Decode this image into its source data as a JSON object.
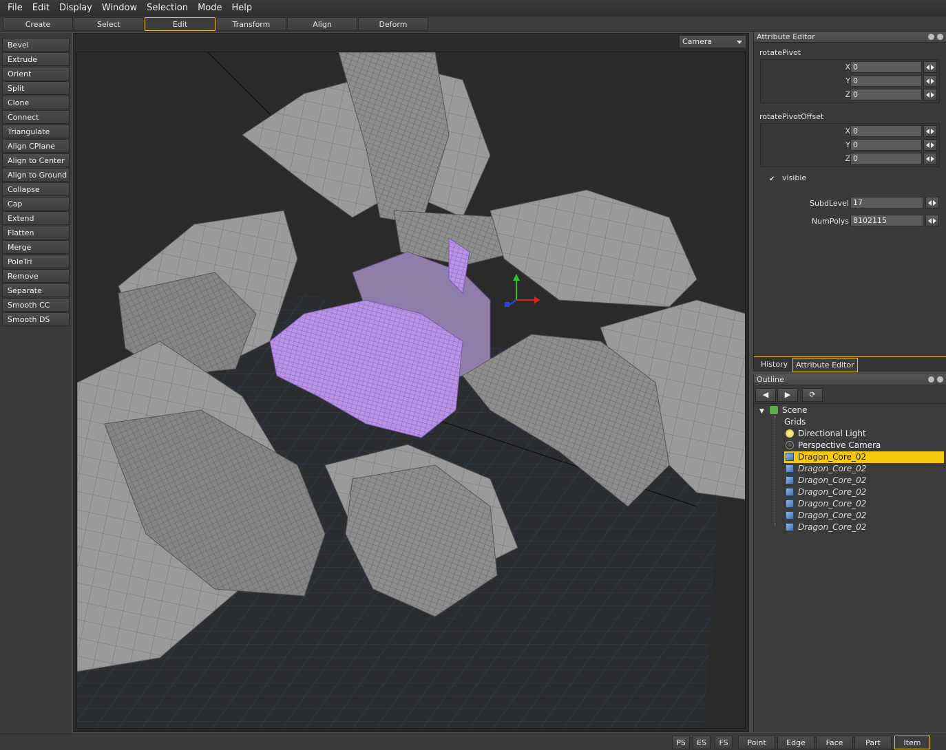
{
  "menubar": {
    "items": [
      "File",
      "Edit",
      "Display",
      "Window",
      "Selection",
      "Mode",
      "Help"
    ]
  },
  "mode_tabs": {
    "items": [
      "Create",
      "Select",
      "Edit",
      "Transform",
      "Align",
      "Deform"
    ],
    "active": "Edit"
  },
  "tools": {
    "items": [
      "Bevel",
      "Extrude",
      "Orient",
      "Split",
      "Clone",
      "Connect",
      "Triangulate",
      "Align CPlane",
      "Align to Center",
      "Align to Ground",
      "Collapse",
      "Cap",
      "Extend",
      "Flatten",
      "Merge",
      "PoleTri",
      "Remove",
      "Separate",
      "Smooth CC",
      "Smooth DS"
    ]
  },
  "viewport": {
    "camera_select": "Camera"
  },
  "attribute_editor": {
    "title": "Attribute Editor",
    "rotate_pivot": {
      "label": "rotatePivot",
      "x_label": "X",
      "x": "0",
      "y_label": "Y",
      "y": "0",
      "z_label": "Z",
      "z": "0"
    },
    "rotate_pivot_offset": {
      "label": "rotatePivotOffset",
      "x_label": "X",
      "x": "0",
      "y_label": "Y",
      "y": "0",
      "z_label": "Z",
      "z": "0"
    },
    "visible_label": "visible",
    "visible_checked": true,
    "subd_level_label": "SubdLevel",
    "subd_level": "17",
    "num_polys_label": "NumPolys",
    "num_polys": "8102115"
  },
  "panel_tabs": {
    "history": "History",
    "attribute_editor": "Attribute Editor"
  },
  "outline": {
    "title": "Outline",
    "scene": "Scene",
    "grids": "Grids",
    "light": "Directional Light",
    "camera": "Perspective Camera",
    "selected_item": "Dragon_Core_02",
    "instances": [
      "Dragon_Core_02",
      "Dragon_Core_02",
      "Dragon_Core_02",
      "Dragon_Core_02",
      "Dragon_Core_02",
      "Dragon_Core_02"
    ]
  },
  "statusbar": {
    "ps": "PS",
    "es": "ES",
    "fs": "FS",
    "point": "Point",
    "edge": "Edge",
    "face": "Face",
    "part": "Part",
    "item": "Item",
    "active": "Item"
  },
  "colors": {
    "accent": "#f0c419",
    "selection_highlight": "#f5c80c",
    "selected_mesh": "#b08be0",
    "mesh": "#8c8c8c",
    "grid": "#2f4a66"
  }
}
